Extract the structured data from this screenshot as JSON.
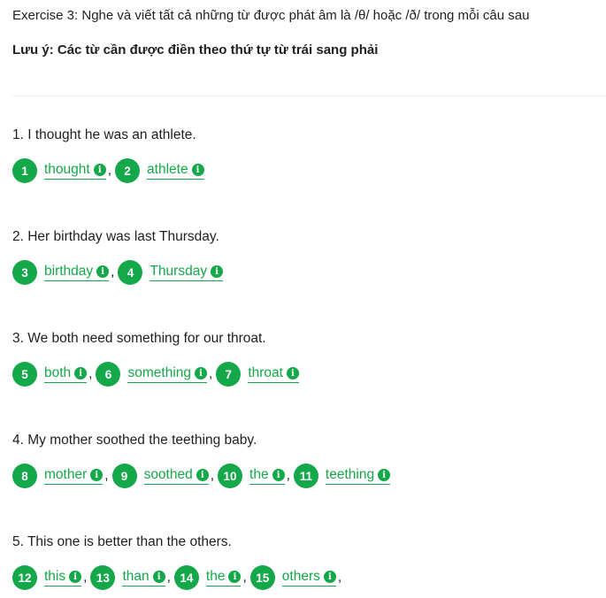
{
  "exercise": {
    "title": "Exercise 3: Nghe và viết tất cả những từ được phát âm là /θ/ hoặc /ð/ trong mỗi câu sau",
    "note": "Lưu ý: Các từ cần được điền theo thứ tự từ trái sang phải"
  },
  "accent_color": "#14a84a",
  "info_icon": "info-circle-icon",
  "questions": [
    {
      "text": "1. I thought he was an athlete.",
      "answers": [
        {
          "num": "1",
          "word": "thought",
          "sep": ","
        },
        {
          "num": "2",
          "word": "athlete",
          "sep": ""
        }
      ]
    },
    {
      "text": "2. Her birthday was last Thursday.",
      "answers": [
        {
          "num": "3",
          "word": "birthday",
          "sep": ","
        },
        {
          "num": "4",
          "word": "Thursday",
          "sep": ""
        }
      ]
    },
    {
      "text": "3. We both need something for our throat.",
      "answers": [
        {
          "num": "5",
          "word": "both",
          "sep": ","
        },
        {
          "num": "6",
          "word": "something",
          "sep": ","
        },
        {
          "num": "7",
          "word": "throat",
          "sep": ""
        }
      ]
    },
    {
      "text": "4. My mother soothed the teething baby.",
      "answers": [
        {
          "num": "8",
          "word": "mother",
          "sep": ","
        },
        {
          "num": "9",
          "word": "soothed",
          "sep": ","
        },
        {
          "num": "10",
          "word": "the",
          "sep": ","
        },
        {
          "num": "11",
          "word": "teething",
          "sep": ""
        }
      ]
    },
    {
      "text": "5. This one is better than the others.",
      "answers": [
        {
          "num": "12",
          "word": "this",
          "sep": ","
        },
        {
          "num": "13",
          "word": "than",
          "sep": ","
        },
        {
          "num": "14",
          "word": "the",
          "sep": ","
        },
        {
          "num": "15",
          "word": "others",
          "sep": ","
        }
      ]
    }
  ]
}
